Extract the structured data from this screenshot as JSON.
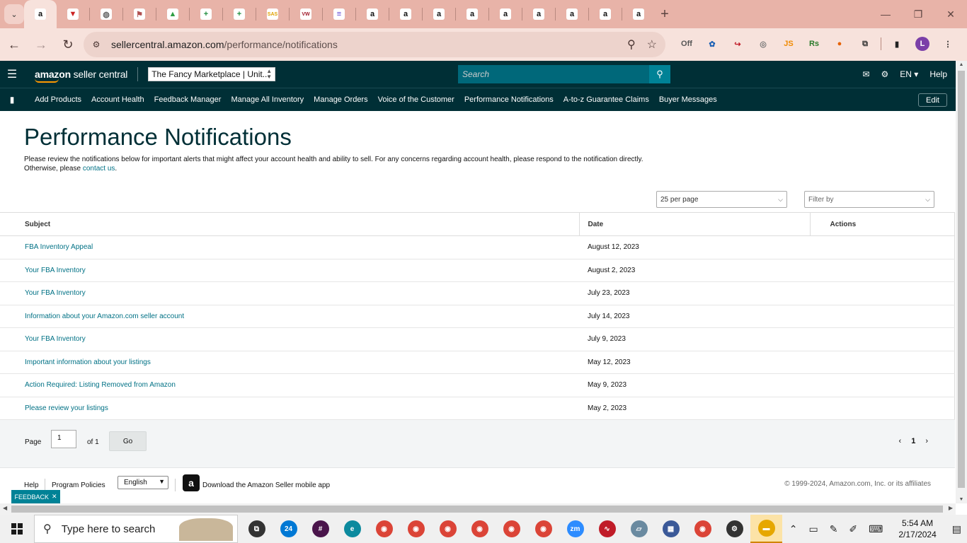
{
  "browser": {
    "url_host": "sellercentral.amazon.com",
    "url_path": "/performance/notifications",
    "tabs": [
      {
        "icon": "amazon-icon",
        "glyph": "a",
        "color": "#111111",
        "active": true
      },
      {
        "icon": "red-v-icon",
        "glyph": "▼",
        "color": "#cc2222",
        "active": false
      },
      {
        "icon": "globe-icon",
        "glyph": "◍",
        "color": "#666666",
        "active": false
      },
      {
        "icon": "flag-icon",
        "glyph": "⚑",
        "color": "#b05050",
        "active": false
      },
      {
        "icon": "google-drive-icon",
        "glyph": "▲",
        "color": "#2f9e44",
        "active": false
      },
      {
        "icon": "green-plus-icon",
        "glyph": "+",
        "color": "#1e8e3e",
        "active": false
      },
      {
        "icon": "green-plus-icon-2",
        "glyph": "+",
        "color": "#1e8e3e",
        "active": false
      },
      {
        "icon": "sas-icon",
        "glyph": "SAS",
        "color": "#e0a000",
        "active": false
      },
      {
        "icon": "vw-icon",
        "glyph": "VW",
        "color": "#a11b2b",
        "active": false
      },
      {
        "icon": "list-icon",
        "glyph": "≡",
        "color": "#5b3fd1",
        "active": false
      },
      {
        "icon": "amazon-icon",
        "glyph": "a",
        "color": "#111111",
        "active": false
      },
      {
        "icon": "amazon-icon",
        "glyph": "a",
        "color": "#111111",
        "active": false
      },
      {
        "icon": "amazon-icon",
        "glyph": "a",
        "color": "#111111",
        "active": false
      },
      {
        "icon": "amazon-icon",
        "glyph": "a",
        "color": "#111111",
        "active": false
      },
      {
        "icon": "amazon-icon",
        "glyph": "a",
        "color": "#111111",
        "active": false
      },
      {
        "icon": "amazon-icon",
        "glyph": "a",
        "color": "#111111",
        "active": false
      },
      {
        "icon": "amazon-icon",
        "glyph": "a",
        "color": "#111111",
        "active": false
      },
      {
        "icon": "amazon-icon",
        "glyph": "a",
        "color": "#111111",
        "active": false
      },
      {
        "icon": "amazon-icon",
        "glyph": "a",
        "color": "#111111",
        "active": false
      }
    ],
    "extensions": [
      {
        "name": "off-extension-icon",
        "glyph": "Off",
        "color": "#555555"
      },
      {
        "name": "blue-dots-extension-icon",
        "glyph": "✿",
        "color": "#1a5fb4"
      },
      {
        "name": "login-extension-icon",
        "glyph": "↪",
        "color": "#c01c28"
      },
      {
        "name": "camera-extension-icon",
        "glyph": "◎",
        "color": "#777777"
      },
      {
        "name": "js-extension-icon",
        "glyph": "JS",
        "color": "#f08a00"
      },
      {
        "name": "rs-extension-icon",
        "glyph": "Rs",
        "color": "#2a7a2a"
      },
      {
        "name": "firefox-style-extension-icon",
        "glyph": "●",
        "color": "#e66100"
      },
      {
        "name": "puzzle-extension-icon",
        "glyph": "⧉",
        "color": "#333333"
      }
    ],
    "profile_initial": "L"
  },
  "header": {
    "logo_main": "amazon",
    "logo_sub": " seller central",
    "marketplace": "The Fancy Marketplace | Unit...",
    "search_placeholder": "Search",
    "language": "EN",
    "help": "Help"
  },
  "nav": {
    "links": [
      "Add Products",
      "Account Health",
      "Feedback Manager",
      "Manage All Inventory",
      "Manage Orders",
      "Voice of the Customer",
      "Performance Notifications",
      "A-to-z Guarantee Claims",
      "Buyer Messages"
    ],
    "edit": "Edit"
  },
  "page": {
    "title": "Performance Notifications",
    "description": "Please review the notifications below for important alerts that might affect your account health and ability to sell. For any concerns regarding account health, please respond to the notification directly.",
    "description_line2_prefix": "Otherwise, please ",
    "contact_link": "contact us",
    "description_line2_suffix": ".",
    "per_page": "25 per page",
    "filter_placeholder": "Filter by"
  },
  "table": {
    "columns": [
      "Subject",
      "Date",
      "Actions"
    ],
    "rows": [
      {
        "subject": "FBA Inventory Appeal",
        "date": "August 12, 2023"
      },
      {
        "subject": "Your FBA Inventory",
        "date": "August 2, 2023"
      },
      {
        "subject": "Your FBA Inventory",
        "date": "July 23, 2023"
      },
      {
        "subject": "Information about your Amazon.com seller account",
        "date": "July 14, 2023"
      },
      {
        "subject": "Your FBA Inventory",
        "date": "July 9, 2023"
      },
      {
        "subject": "Important information about your listings",
        "date": "May 12, 2023"
      },
      {
        "subject": "Action Required: Listing Removed from Amazon",
        "date": "May 9, 2023"
      },
      {
        "subject": "Please review your listings",
        "date": "May 2, 2023"
      }
    ]
  },
  "pager": {
    "page_label": "Page",
    "page_value": "1",
    "of_label": "of 1",
    "go": "Go",
    "current": "1"
  },
  "footer": {
    "help": "Help",
    "program_policies": "Program Policies",
    "language": "English",
    "app_text": "Download the Amazon Seller mobile app",
    "copyright": "© 1999-2024, Amazon.com, Inc. or its affiliates",
    "feedback": "FEEDBACK"
  },
  "taskbar": {
    "search_placeholder": "Type here to search",
    "apps": [
      {
        "name": "task-view-icon",
        "glyph": "⧉",
        "color": "#333333"
      },
      {
        "name": "email-app-icon",
        "glyph": "24",
        "color": "#0078d4"
      },
      {
        "name": "slack-icon",
        "glyph": "#",
        "color": "#4a154b"
      },
      {
        "name": "edge-icon",
        "glyph": "e",
        "color": "#0c8a9e"
      },
      {
        "name": "chrome-icon",
        "glyph": "◉",
        "color": "#db4437"
      },
      {
        "name": "chrome-icon",
        "glyph": "◉",
        "color": "#db4437"
      },
      {
        "name": "chrome-icon",
        "glyph": "◉",
        "color": "#db4437"
      },
      {
        "name": "chrome-icon",
        "glyph": "◉",
        "color": "#db4437"
      },
      {
        "name": "chrome-icon",
        "glyph": "◉",
        "color": "#db4437"
      },
      {
        "name": "chrome-icon",
        "glyph": "◉",
        "color": "#db4437"
      },
      {
        "name": "zoom-icon",
        "glyph": "zm",
        "color": "#2d8cff"
      },
      {
        "name": "voice-app-icon",
        "glyph": "∿",
        "color": "#c01c28"
      },
      {
        "name": "book-app-icon",
        "glyph": "▱",
        "color": "#6a8aa0"
      },
      {
        "name": "calculator-icon",
        "glyph": "▦",
        "color": "#3b5998"
      },
      {
        "name": "chrome-icon",
        "glyph": "◉",
        "color": "#db4437"
      },
      {
        "name": "settings-icon",
        "glyph": "⚙",
        "color": "#333333"
      },
      {
        "name": "file-explorer-icon",
        "glyph": "▬",
        "color": "#e6a700"
      }
    ],
    "time": "5:54 AM",
    "date": "2/17/2024"
  }
}
